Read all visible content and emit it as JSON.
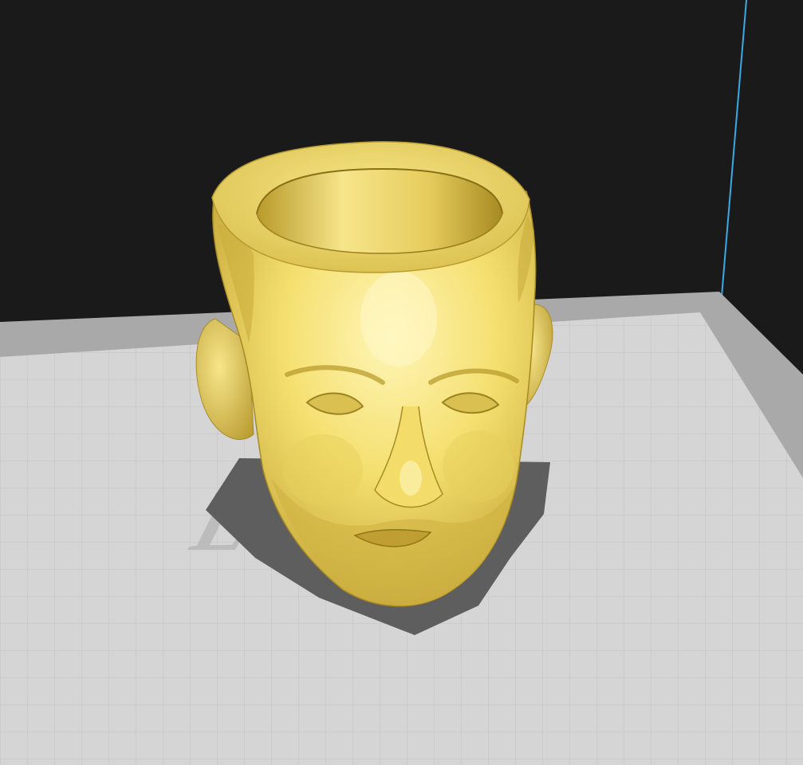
{
  "app": {
    "view": "3d-viewport",
    "background_color": "#1a1a1a"
  },
  "build_plate": {
    "surface_color": "#d5d5d5",
    "rim_color": "#a9a9a9",
    "grid_color": "#c2c2c2",
    "logo_text": "Ender"
  },
  "volume_edge": {
    "color": "#3aa9e6"
  },
  "model": {
    "name": "head-planter",
    "color": "#f5e27a",
    "shadow_color": "#5e5e5e"
  }
}
